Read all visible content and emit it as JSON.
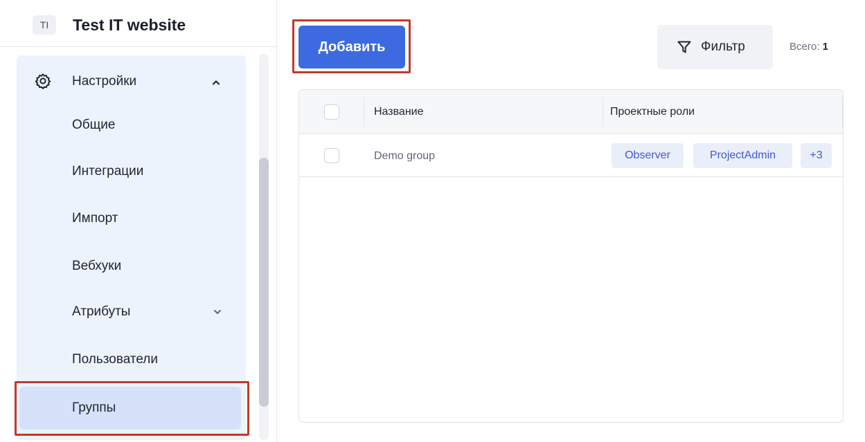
{
  "project": {
    "avatar": "TI",
    "name": "Test IT website"
  },
  "sidebar": {
    "section": {
      "label": "Настройки",
      "icon": "gear-icon",
      "expanded": true
    },
    "items": [
      {
        "label": "Общие"
      },
      {
        "label": "Интеграции"
      },
      {
        "label": "Импорт"
      },
      {
        "label": "Вебхуки"
      },
      {
        "label": "Атрибуты",
        "has_submenu": true
      },
      {
        "label": "Пользователи"
      },
      {
        "label": "Группы",
        "active": true
      }
    ]
  },
  "toolbar": {
    "add_label": "Добавить",
    "filter_label": "Фильтр",
    "total_label": "Всего:",
    "total_value": "1"
  },
  "table": {
    "columns": [
      "Название",
      "Проектные роли"
    ],
    "rows": [
      {
        "name": "Demo group",
        "roles": [
          "Observer",
          "ProjectAdmin"
        ],
        "more": "+3"
      }
    ]
  },
  "colors": {
    "accent": "#3d6ae0",
    "nav_bg": "#edf3fd",
    "active_item": "#d6e2fa",
    "highlight": "#c0392b",
    "tag_text": "#3d5ad8"
  }
}
